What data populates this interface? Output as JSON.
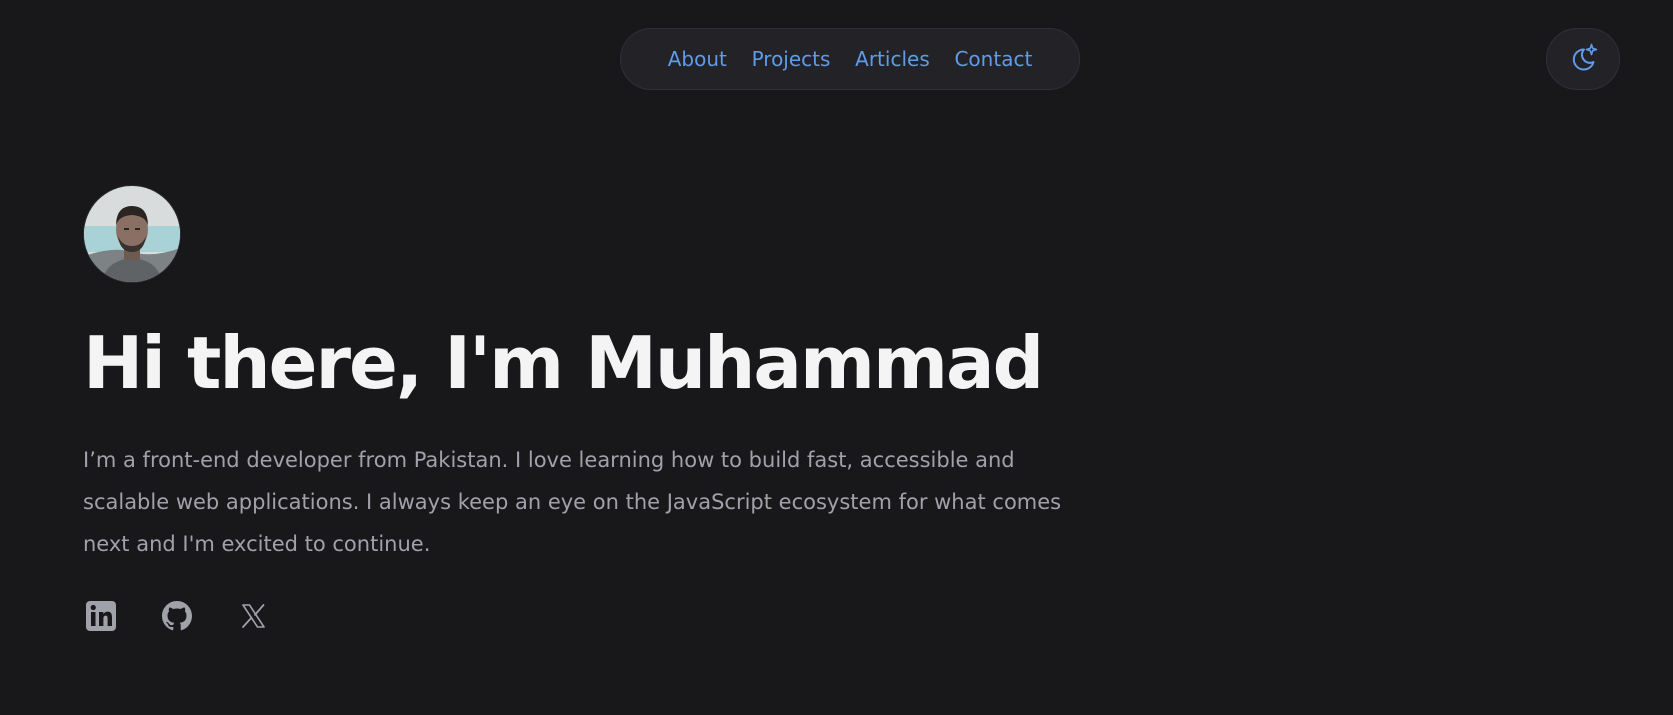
{
  "nav": {
    "items": [
      {
        "label": "About"
      },
      {
        "label": "Projects"
      },
      {
        "label": "Articles"
      },
      {
        "label": "Contact"
      }
    ]
  },
  "theme_toggle": {
    "icon": "moon-sparkle-icon"
  },
  "hero": {
    "title": "Hi there, I'm Muhammad",
    "bio": "I’m a front-end developer from Pakistan. I love learning how to build fast, accessible and scalable web applications. I always keep an eye on the JavaScript ecosystem for what comes next and I'm excited to continue."
  },
  "socials": [
    {
      "icon": "linkedin-icon"
    },
    {
      "icon": "github-icon"
    },
    {
      "icon": "x-icon"
    }
  ],
  "colors": {
    "background": "#18181b",
    "accent": "#5f9be8",
    "heading": "#f4f4f5",
    "body_text": "#a1a1aa"
  }
}
